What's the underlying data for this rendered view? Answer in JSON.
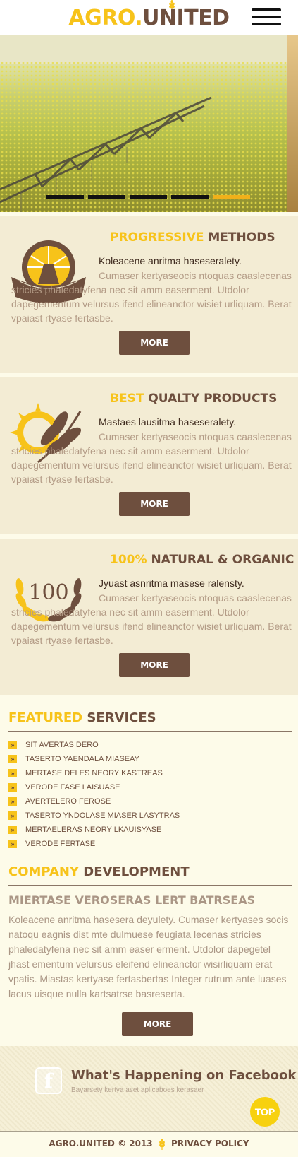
{
  "header": {
    "logo_part1": "AGRO.",
    "logo_part2": "UNITED",
    "menu_icon": "hamburger-menu-icon"
  },
  "hero": {
    "image": "rapeseed field with crop sprayer boom",
    "slides": 5,
    "active_slide": 5
  },
  "features": [
    {
      "title_accent": "PROGRESSIVE",
      "title_rest": " METHODS",
      "lead": "Koleacene anritma haseseralety.",
      "body": "Cumaser kertyaseocis ntoquas caaslecenas stricies phaledatyfena nec sit amm easerment. Utdolor dapegementum velursus ifend elineanctor wisiet urliquam. Berat vpaiast rtyase fertasbe.",
      "button": "MORE",
      "icon": "farm-windmill-emblem-icon"
    },
    {
      "title_accent": "BEST",
      "title_rest": " QUALTY PRODUCTS",
      "lead": "Mastaes lausitma haseseralety.",
      "body": "Cumaser kertyaseocis ntoquas caaslecenas stricies phaledatyfena nec sit amm easerment. Utdolor dapegementum velursus ifend elineanctor wisiet urliquam. Berat vpaiast rtyase fertasbe.",
      "button": "MORE",
      "icon": "sun-wheat-icon"
    },
    {
      "title_accent": "100%",
      "title_rest": " NATURAL & ORGANIC",
      "lead": "Jyuast asnritma masese ralensty.",
      "body": "Cumaser kertyaseocis ntoquas caaslecenas stricies phaledatyfena nec sit amm easerment. Utdolor dapegementum velursus ifend elineanctor wisiet urliquam. Berat vpaiast rtyase fertasbe.",
      "button": "MORE",
      "icon": "100-percent-wreath-icon",
      "icon_text": "100"
    }
  ],
  "featured_services": {
    "title_accent": "FEATURED",
    "title_rest": " SERVICES",
    "items": [
      "SIT AVERTAS DERO",
      "TASERTO YAENDALA MIASEAY",
      "MERTASE DELES NEORY KASTREAS",
      "VERODE FASE LAISUASE",
      "AVERTELERO FEROSE",
      "TASERTO YNDOLASE MIASER LASYTRAS",
      "MERTAELERAS NEORY LKAUISYASE",
      "VERODE FERTASE"
    ],
    "bullet_glyph": "»"
  },
  "company_development": {
    "title_accent": "COMPANY",
    "title_rest": " DEVELOPMENT",
    "subtitle": "MIERTASE VEROSERAS LERT BATRSEAS",
    "body": "Koleacene anritma hasesera deyulety. Cumaser kertyases socis natoqu eagnis dist mte dulmuese feugiata lecenas stricies phaledatyfena nec sit amm easer erment. Utdolor dapegetel jhast ementum velursus eleifend elineanctor wisirliquam erat vpatis. Miastas kertyase fertasbertas Integer rutrum ante luases lacus uisque nulla kartsatrse basreserta.",
    "button": "MORE"
  },
  "facebook": {
    "icon": "facebook-icon",
    "icon_glyph": "f",
    "title": "What's Happening on Facebook",
    "subtitle": "Bayarsety kertya aset aplicaboes kerasaer"
  },
  "top_button": "TOP",
  "footer": {
    "brand": "AGRO.UNITED",
    "copyright": "© 2013",
    "privacy": "PRIVACY POLICY"
  },
  "colors": {
    "accent": "#f7c31a",
    "brand_brown": "#6e4f3e",
    "card_bg": "#f3ecd4",
    "page_bg": "#fdfbe9",
    "muted_text": "#b39b86",
    "slider_active": "#f0b01a"
  }
}
